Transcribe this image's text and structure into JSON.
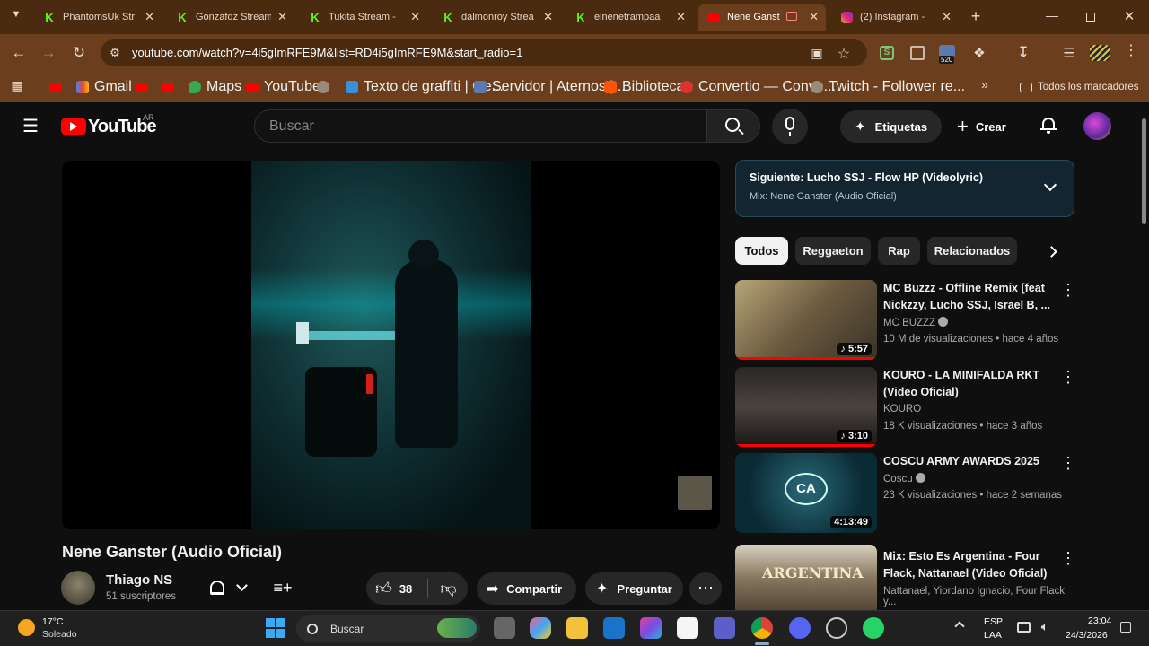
{
  "tabs": [
    {
      "title": "PhantomsUk Str",
      "icon": "kick-icon"
    },
    {
      "title": "Gonzafdz Stream",
      "icon": "kick-icon"
    },
    {
      "title": "Tukita Stream -",
      "icon": "kick-icon"
    },
    {
      "title": "dalmonroy Strea",
      "icon": "kick-icon"
    },
    {
      "title": "elnenetrampaa",
      "icon": "kick-icon"
    },
    {
      "title": "Nene Ganst",
      "icon": "youtube-icon"
    },
    {
      "title": "(2) Instagram -",
      "icon": "instagram-icon"
    }
  ],
  "address_bar": {
    "url": "youtube.com/watch?v=4i5gImRFE9M&list=RD4i5gImRFE9M&start_radio=1"
  },
  "extension_badge": "520",
  "bookmarks": [
    {
      "label": ""
    },
    {
      "label": "Gmail"
    },
    {
      "label": ""
    },
    {
      "label": ""
    },
    {
      "label": "Maps"
    },
    {
      "label": "YouTube"
    },
    {
      "label": ""
    },
    {
      "label": "Texto de graffiti | Ge..."
    },
    {
      "label": "Servidor | Aternos |..."
    },
    {
      "label": "Biblioteca"
    },
    {
      "label": "Convertio — Conve..."
    },
    {
      "label": "Twitch - Follower re..."
    }
  ],
  "bookmarks_all": "Todos los marcadores",
  "youtube": {
    "logo_text": "YouTube",
    "country": "AR",
    "search_placeholder": "Buscar",
    "tags_button": "Etiquetas",
    "create_button": "Crear"
  },
  "video": {
    "title": "Nene Ganster (Audio Oficial)",
    "channel": "Thiago NS",
    "subscribers": "51 suscriptores",
    "likes": "38",
    "share": "Compartir",
    "ask": "Preguntar"
  },
  "playlist": {
    "next": "Siguiente: Lucho SSJ - Flow HP (Videolyric)",
    "mix": "Mix: Nene Ganster (Audio Oficial)"
  },
  "chips": [
    "Todos",
    "Reggaeton",
    "Rap",
    "Relacionados"
  ],
  "recommendations": [
    {
      "title": "MC Buzzz - Offline Remix [feat Nickzzy, Lucho SSJ, Israel B, ...",
      "channel": "MC BUZZZ",
      "meta": "10 M de visualizaciones • hace 4 años",
      "duration": "5:57",
      "verified": true,
      "color": "#8a7a55"
    },
    {
      "title": "KOURO - LA MINIFALDA RKT (Video Oficial)",
      "channel": "KOURO",
      "meta": "18 K visualizaciones • hace 3 años",
      "duration": "3:10",
      "verified": false,
      "color": "#3a3330"
    },
    {
      "title": "COSCU ARMY AWARDS 2025",
      "channel": "Coscu",
      "meta": "23 K visualizaciones • hace 2 semanas",
      "duration": "4:13:49",
      "verified": true,
      "color": "#0c2f3a"
    },
    {
      "title": "Mix: Esto Es Argentina - Four Flack, Nattanael (Video Oficial)",
      "channel": "Nattanael, Yiordano Ignacio, Four Flack y...",
      "meta": "",
      "duration": "",
      "verified": false,
      "color": "#5a4a38"
    }
  ],
  "taskbar": {
    "weather_temp": "17°C",
    "weather_desc": "Soleado",
    "search": "Buscar",
    "lang1": "ESP",
    "lang2": "LAA",
    "time": "23:04",
    "date": "24/3/2026"
  },
  "colors": {
    "browser": "#6b3f1d",
    "tabstrip": "#4a2b10",
    "youtube_red": "#ff0000",
    "background": "#0f0f0f"
  }
}
